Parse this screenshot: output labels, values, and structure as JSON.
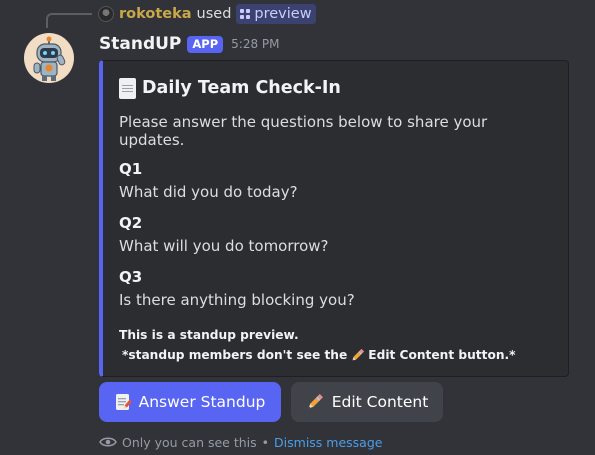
{
  "reply": {
    "username": "rokoteka",
    "used_text": "used",
    "command": "preview"
  },
  "message": {
    "bot_name": "StandUP",
    "badge": "APP",
    "timestamp": "5:28 PM"
  },
  "embed": {
    "accent_color": "#5865f2",
    "title_icon": "memo-icon",
    "title": "Daily Team Check-In",
    "description": "Please answer the questions below to share your updates.",
    "fields": [
      {
        "name": "Q1",
        "value": "What did you do today?"
      },
      {
        "name": "Q2",
        "value": "What will you do tomorrow?"
      },
      {
        "name": "Q3",
        "value": "Is there anything blocking you?"
      }
    ],
    "note_line1": "This is a standup preview.",
    "note_line2_before": "*standup members don't see the",
    "note_line2_after": "Edit Content button.*"
  },
  "buttons": {
    "answer": {
      "label": "Answer Standup",
      "icon": "memo-icon"
    },
    "edit": {
      "label": "Edit Content",
      "icon": "pencil-icon"
    }
  },
  "ephemeral": {
    "icon": "eye-icon",
    "text": "Only you can see this",
    "separator": "•",
    "dismiss": "Dismiss message"
  }
}
